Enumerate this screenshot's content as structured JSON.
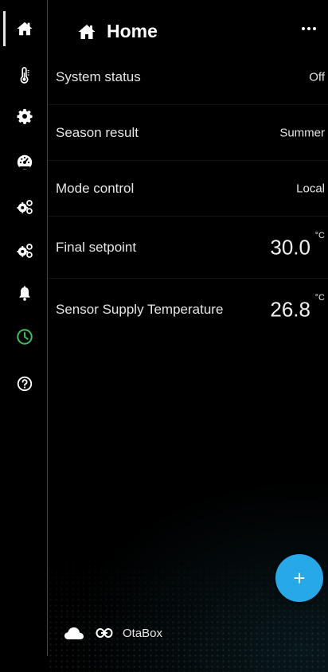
{
  "header": {
    "title": "Home",
    "home_icon": "home-icon",
    "menu_icon": "more-horizontal-icon"
  },
  "sidebar": {
    "items": [
      {
        "name": "home",
        "icon": "home-icon",
        "active": true,
        "color": "#ffffff"
      },
      {
        "name": "thermometer",
        "icon": "thermometer-icon",
        "active": false,
        "color": "#ffffff"
      },
      {
        "name": "settings",
        "icon": "gear-icon",
        "active": false,
        "color": "#ffffff"
      },
      {
        "name": "dashboard",
        "icon": "gauge-icon",
        "active": false,
        "color": "#ffffff"
      },
      {
        "name": "advanced-settings-1",
        "icon": "gears-icon",
        "active": false,
        "color": "#ffffff"
      },
      {
        "name": "advanced-settings-2",
        "icon": "gears-icon",
        "active": false,
        "color": "#ffffff"
      },
      {
        "name": "alarms",
        "icon": "bell-icon",
        "active": false,
        "color": "#ffffff"
      },
      {
        "name": "schedule",
        "icon": "clock-icon",
        "active": false,
        "color": "#3fbf5a"
      },
      {
        "name": "help",
        "icon": "help-circle-icon",
        "active": false,
        "color": "#ffffff"
      }
    ]
  },
  "rows": [
    {
      "label": "System status",
      "value": "Off",
      "unit": ""
    },
    {
      "label": "Season result",
      "value": "Summer",
      "unit": ""
    },
    {
      "label": "Mode control",
      "value": "Local",
      "unit": ""
    },
    {
      "label": "Final setpoint",
      "value": "30.0",
      "unit": "°C"
    },
    {
      "label": "Sensor Supply Temperature",
      "value": "26.8",
      "unit": "°C"
    }
  ],
  "fab": {
    "label": "+",
    "icon": "plus-icon",
    "color": "#27a8e8"
  },
  "footer": {
    "cloud_icon": "cloud-icon",
    "link_icon": "link-icon",
    "label": "OtaBox"
  }
}
